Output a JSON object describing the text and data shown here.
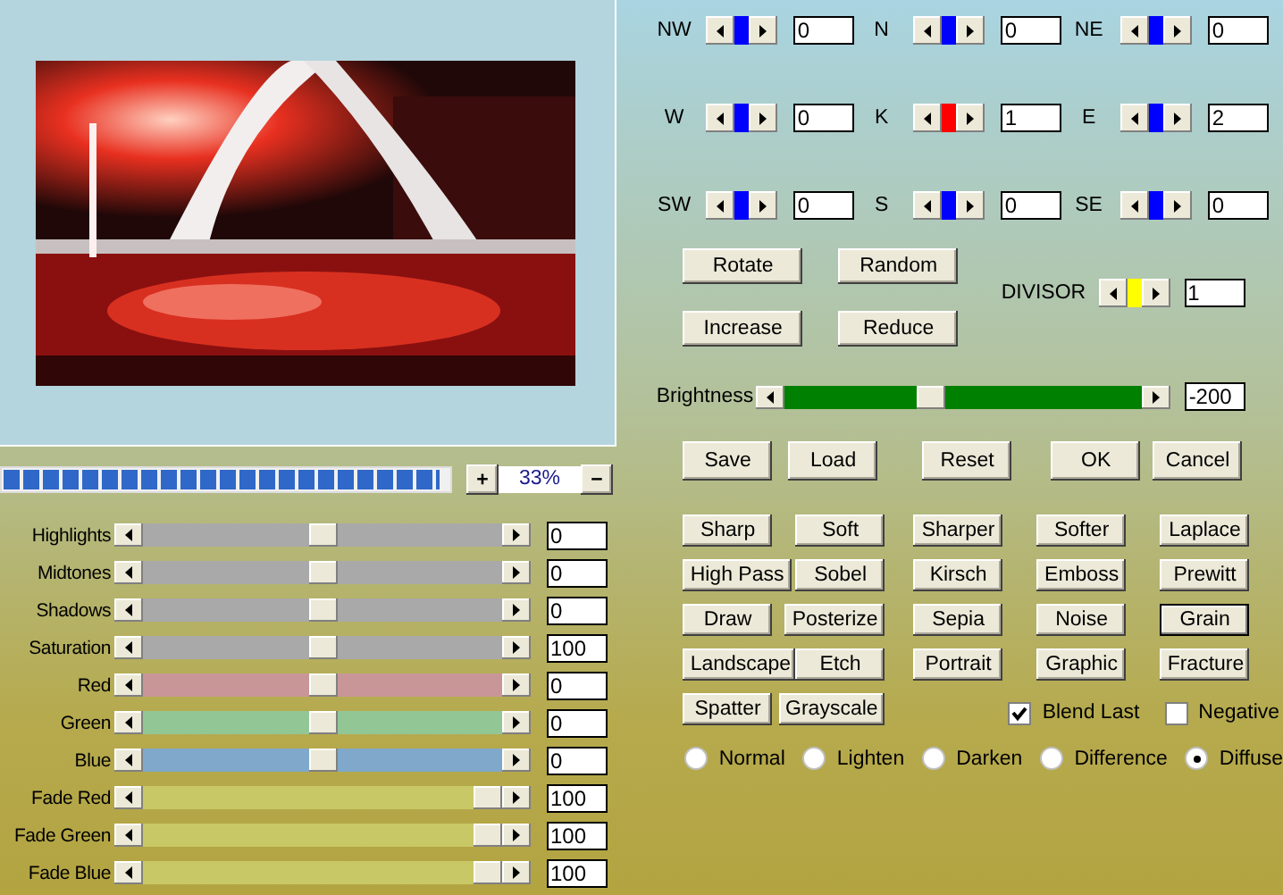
{
  "preview": {
    "kind": "picture"
  },
  "zoom": {
    "level": 0.98,
    "increase": "+",
    "value": "33%",
    "decrease": "−"
  },
  "adjustments": [
    {
      "label": "Highlights",
      "level": 0.5,
      "value": "0",
      "color": "#a9a9a9"
    },
    {
      "label": "Midtones",
      "level": 0.5,
      "value": "0",
      "color": "#a9a9a9"
    },
    {
      "label": "Shadows",
      "level": 0.5,
      "value": "0",
      "color": "#a9a9a9"
    },
    {
      "label": "Saturation",
      "level": 0.5,
      "value": "100",
      "color": "#a9a9a9"
    },
    {
      "label": "Red",
      "level": 0.5,
      "value": "0",
      "color": "#c99698"
    },
    {
      "label": "Green",
      "level": 0.5,
      "value": "0",
      "color": "#92c795"
    },
    {
      "label": "Blue",
      "level": 0.5,
      "value": "0",
      "color": "#7fa8ca"
    },
    {
      "label": "Fade Red",
      "level": 1,
      "value": "100",
      "color": "#c9c866"
    },
    {
      "label": "Fade Green",
      "level": 1,
      "value": "100",
      "color": "#c9c866"
    },
    {
      "label": "Fade Blue",
      "level": 1,
      "value": "100",
      "color": "#c9c866"
    }
  ],
  "kernel": [
    {
      "label": "NW",
      "value": "0",
      "color": "#0000ff"
    },
    {
      "label": "N",
      "value": "0",
      "color": "#0000ff"
    },
    {
      "label": "NE",
      "value": "0",
      "color": "#0000ff"
    },
    {
      "label": "W",
      "value": "0",
      "color": "#0000ff"
    },
    {
      "label": "K",
      "value": "1",
      "color": "#ff0000"
    },
    {
      "label": "E",
      "value": "2",
      "color": "#0000ff"
    },
    {
      "label": "SW",
      "value": "0",
      "color": "#0000ff"
    },
    {
      "label": "S",
      "value": "0",
      "color": "#0000ff"
    },
    {
      "label": "SE",
      "value": "0",
      "color": "#0000ff"
    }
  ],
  "kernel_buttons": [
    "Rotate",
    "Random",
    "Increase",
    "Reduce"
  ],
  "divisor": {
    "label": "DIVISOR",
    "value": "1",
    "color": "#ffff00"
  },
  "brightness": {
    "label": "Brightness",
    "level": 0.4,
    "value": "-200"
  },
  "actions": [
    "Save",
    "Load",
    "Reset",
    "OK",
    "Cancel"
  ],
  "filter_rows": [
    [
      {
        "label": "Sharp",
        "selected": false
      },
      {
        "label": "Soft",
        "selected": false
      },
      {
        "label": "Sharper",
        "selected": false
      },
      {
        "label": "Softer",
        "selected": false
      },
      {
        "label": "Laplace",
        "selected": false
      }
    ],
    [
      {
        "label": "High Pass",
        "selected": false
      },
      {
        "label": "Sobel",
        "selected": false
      },
      {
        "label": "Kirsch",
        "selected": false
      },
      {
        "label": "Emboss",
        "selected": false
      },
      {
        "label": "Prewitt",
        "selected": false
      }
    ],
    [
      {
        "label": "Draw",
        "selected": false
      },
      {
        "label": "Posterize",
        "selected": false
      },
      {
        "label": "Sepia",
        "selected": false
      },
      {
        "label": "Noise",
        "selected": false
      },
      {
        "label": "Grain",
        "selected": true
      }
    ],
    [
      {
        "label": "Landscape",
        "selected": false
      },
      {
        "label": "Etch",
        "selected": false
      },
      {
        "label": "Portrait",
        "selected": false
      },
      {
        "label": "Graphic",
        "selected": false
      },
      {
        "label": "Fracture",
        "selected": false
      }
    ],
    [
      {
        "label": "Spatter",
        "selected": false
      },
      {
        "label": "Grayscale",
        "selected": false
      }
    ]
  ],
  "options": [
    {
      "label": "Blend Last",
      "checked": true
    },
    {
      "label": "Negative",
      "checked": false
    }
  ],
  "blend_modes": [
    {
      "label": "Normal",
      "selected": false
    },
    {
      "label": "Lighten",
      "selected": false
    },
    {
      "label": "Darken",
      "selected": false
    },
    {
      "label": "Difference",
      "selected": false
    },
    {
      "label": "Diffuse",
      "selected": true
    }
  ]
}
